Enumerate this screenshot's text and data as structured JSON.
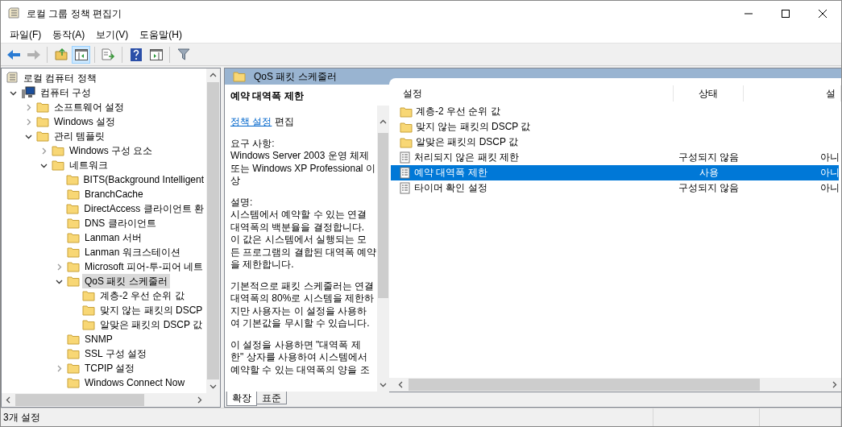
{
  "window": {
    "title": "로컬 그룹 정책 편집기"
  },
  "menu": [
    "파일(F)",
    "동작(A)",
    "보기(V)",
    "도움말(H)"
  ],
  "toolbar": [
    {
      "kind": "back",
      "disabled": false,
      "pressed": false
    },
    {
      "kind": "forward",
      "disabled": true,
      "pressed": false
    },
    {
      "kind": "separator"
    },
    {
      "kind": "up",
      "disabled": false,
      "pressed": false
    },
    {
      "kind": "tree",
      "disabled": false,
      "pressed": true
    },
    {
      "kind": "separator"
    },
    {
      "kind": "export",
      "disabled": false,
      "pressed": false
    },
    {
      "kind": "separator"
    },
    {
      "kind": "help",
      "disabled": false,
      "pressed": false
    },
    {
      "kind": "pane",
      "disabled": false,
      "pressed": false
    },
    {
      "kind": "separator"
    },
    {
      "kind": "filter",
      "disabled": false,
      "pressed": false
    }
  ],
  "tree": [
    {
      "label": "로컬 컴퓨터 정책",
      "kind": "policy",
      "selected": false,
      "children": [
        {
          "label": "컴퓨터 구성",
          "kind": "computer",
          "expanded": true,
          "selected": false,
          "children": [
            {
              "label": "소프트웨어 설정",
              "kind": "folder",
              "expanded": false,
              "selected": false
            },
            {
              "label": "Windows 설정",
              "kind": "folder",
              "expanded": false,
              "selected": false
            },
            {
              "label": "관리 템플릿",
              "kind": "folder",
              "expanded": true,
              "selected": false,
              "children": [
                {
                  "label": "Windows 구성 요소",
                  "kind": "folder",
                  "expanded": false,
                  "selected": false
                },
                {
                  "label": "네트워크",
                  "kind": "folder",
                  "expanded": true,
                  "selected": false,
                  "children": [
                    {
                      "label": "BITS(Background Intelligent",
                      "kind": "folder",
                      "selected": false
                    },
                    {
                      "label": "BranchCache",
                      "kind": "folder",
                      "selected": false
                    },
                    {
                      "label": "DirectAccess 클라이언트 환",
                      "kind": "folder",
                      "selected": false
                    },
                    {
                      "label": "DNS 클라이언트",
                      "kind": "folder",
                      "selected": false
                    },
                    {
                      "label": "Lanman 서버",
                      "kind": "folder",
                      "selected": false
                    },
                    {
                      "label": "Lanman 워크스테이션",
                      "kind": "folder",
                      "selected": false
                    },
                    {
                      "label": "Microsoft 피어-투-피어 네트",
                      "kind": "folder",
                      "expanded": false,
                      "selected": false
                    },
                    {
                      "label": "QoS 패킷 스케줄러",
                      "kind": "folder",
                      "expanded": true,
                      "selected": true,
                      "children": [
                        {
                          "label": "계층-2 우선 순위 값",
                          "kind": "folder",
                          "selected": false
                        },
                        {
                          "label": "맞지 않는 패킷의 DSCP",
                          "kind": "folder",
                          "selected": false
                        },
                        {
                          "label": "알맞은 패킷의 DSCP 값",
                          "kind": "folder",
                          "selected": false
                        }
                      ]
                    },
                    {
                      "label": "SNMP",
                      "kind": "folder",
                      "selected": false
                    },
                    {
                      "label": "SSL 구성 설정",
                      "kind": "folder",
                      "selected": false
                    },
                    {
                      "label": "TCPIP 설정",
                      "kind": "folder",
                      "expanded": false,
                      "selected": false
                    },
                    {
                      "label": "Windows Connect Now",
                      "kind": "folder",
                      "selected": false
                    }
                  ]
                }
              ]
            }
          ]
        }
      ]
    }
  ],
  "detail": {
    "header": "QoS 패킷 스케줄러",
    "title": "예약 대역폭 제한",
    "edit_link": "정책 설정",
    "edit_suffix": "편집",
    "paragraphs": [
      {
        "lines": [
          "요구 사항:",
          "Windows Server 2003 운영 체제",
          "또는 Windows XP Professional 이",
          "상"
        ]
      },
      {
        "lines": [
          "설명:",
          "시스템에서 예약할 수 있는 연결",
          "대역폭의 백분율을 결정합니다.",
          "이 값은 시스템에서 실행되는 모",
          "든 프로그램의 결합된 대역폭 예약",
          "을 제한합니다."
        ]
      },
      {
        "lines": [
          "기본적으로 패킷 스케줄러는 연결",
          "대역폭의 80%로 시스템을 제한하",
          "지만 사용자는 이 설정을 사용하",
          "여 기본값을 무시할 수 있습니다."
        ]
      },
      {
        "lines": [
          "이 설정을 사용하면 \"대역폭 제",
          "한\" 상자를 사용하여 시스템에서",
          "예약할 수 있는 대역폭의 양을 조"
        ]
      }
    ],
    "tabs": [
      {
        "label": "확장",
        "selected": true
      },
      {
        "label": "표준",
        "selected": false
      }
    ]
  },
  "list": {
    "columns": [
      "설정",
      "상태",
      "설"
    ],
    "rows": [
      {
        "kind": "folder",
        "name": "계층-2 우선 순위 값",
        "selected": false
      },
      {
        "kind": "folder",
        "name": "맞지 않는 패킷의 DSCP 값",
        "selected": false
      },
      {
        "kind": "folder",
        "name": "알맞은 패킷의 DSCP 값",
        "selected": false
      },
      {
        "kind": "setting",
        "name": "처리되지 않은 패킷 제한",
        "state": "구성되지 않음",
        "column_3": "아니",
        "selected": false
      },
      {
        "kind": "setting",
        "name": "예약 대역폭 제한",
        "state": "사용",
        "column_3": "아니",
        "selected": true
      },
      {
        "kind": "setting",
        "name": "타이머 확인 설정",
        "state": "구성되지 않음",
        "column_3": "아니",
        "selected": false
      }
    ]
  },
  "status_bar": "3개 설정"
}
